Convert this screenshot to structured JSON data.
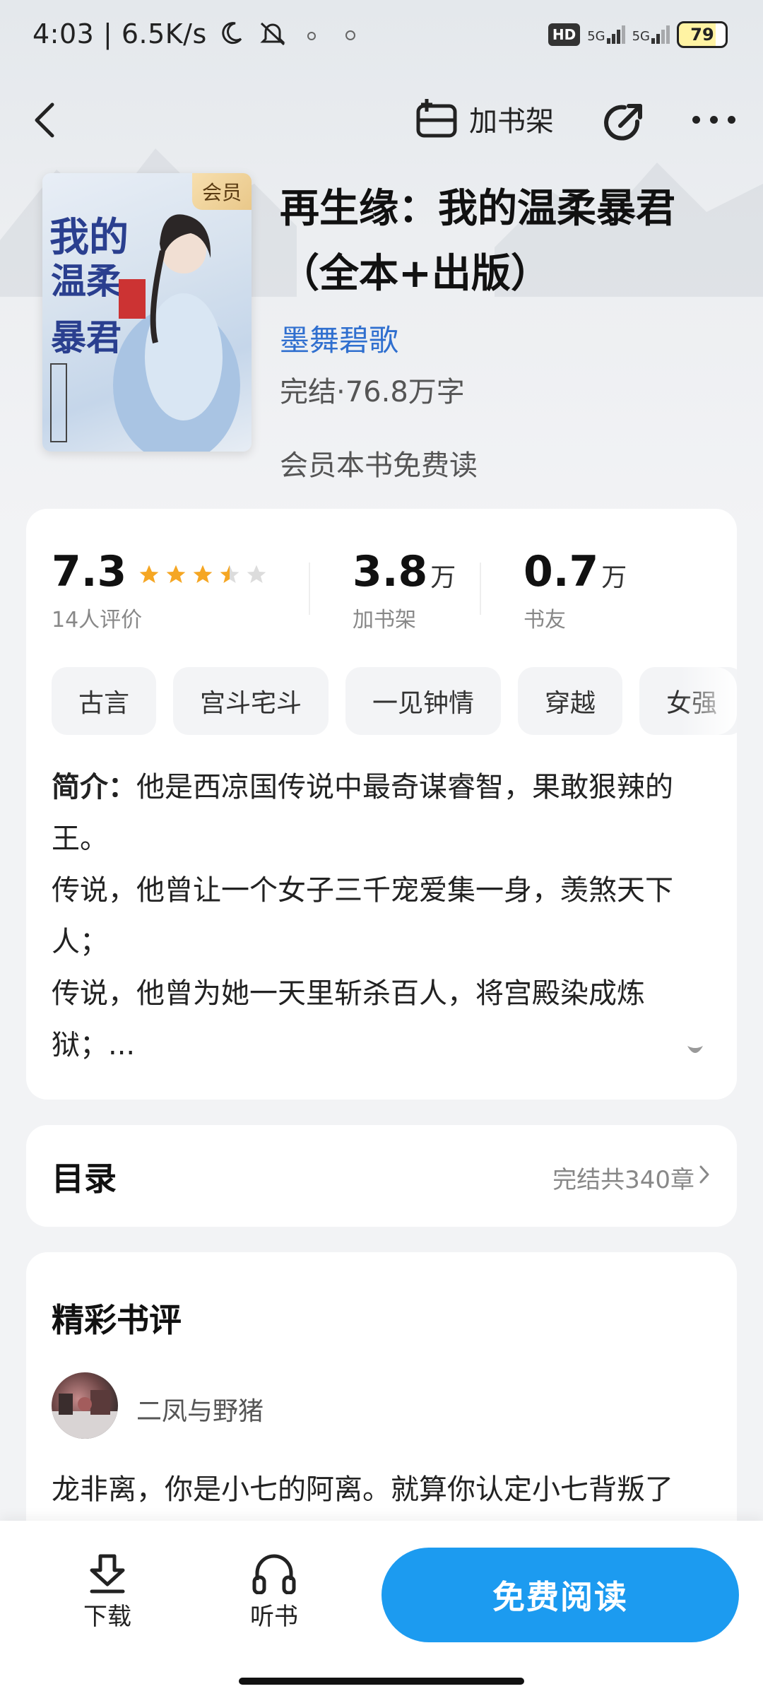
{
  "status_bar": {
    "time": "4:03",
    "speed": "6.5K/s",
    "network1": "5G",
    "network2": "5G",
    "battery": "79",
    "hd": "HD"
  },
  "nav": {
    "add_shelf_label": "加书架"
  },
  "book": {
    "cover_badge": "会员",
    "title": "再生缘：我的温柔暴君（全本+出版）",
    "author": "墨舞碧歌",
    "status": "完结·76.8万字",
    "vip_note": "会员本书免费读"
  },
  "stats": {
    "rating": "7.3",
    "rating_stars": 3.5,
    "rating_count": "14人评价",
    "shelf_value": "3.8",
    "shelf_unit": "万",
    "shelf_label": "加书架",
    "fans_value": "0.7",
    "fans_unit": "万",
    "fans_label": "书友"
  },
  "tags": [
    "古言",
    "宫斗宅斗",
    "一见钟情",
    "穿越",
    "女强"
  ],
  "intro": {
    "prefix": "简介：",
    "line1": "他是西凉国传说中最奇谋睿智，果敢狠辣的王。",
    "line2": "传说，他曾让一个女子三千宠爱集一身，羡煞天下人；",
    "line3": "传说，他曾为她一天里斩杀百人，将宫殿染成炼狱；..."
  },
  "toc": {
    "title": "目录",
    "info": "完结共340章"
  },
  "reviews": {
    "title": "精彩书评",
    "reviewer": "二凤与野猪",
    "text": "龙非离，你是小七的阿离。就算你认定小七背叛了"
  },
  "bottom": {
    "download_label": "下载",
    "listen_label": "听书",
    "read_label": "免费阅读"
  },
  "colors": {
    "accent": "#1c9bf0",
    "author_link": "#2f6fcf",
    "star": "#f5a623"
  }
}
